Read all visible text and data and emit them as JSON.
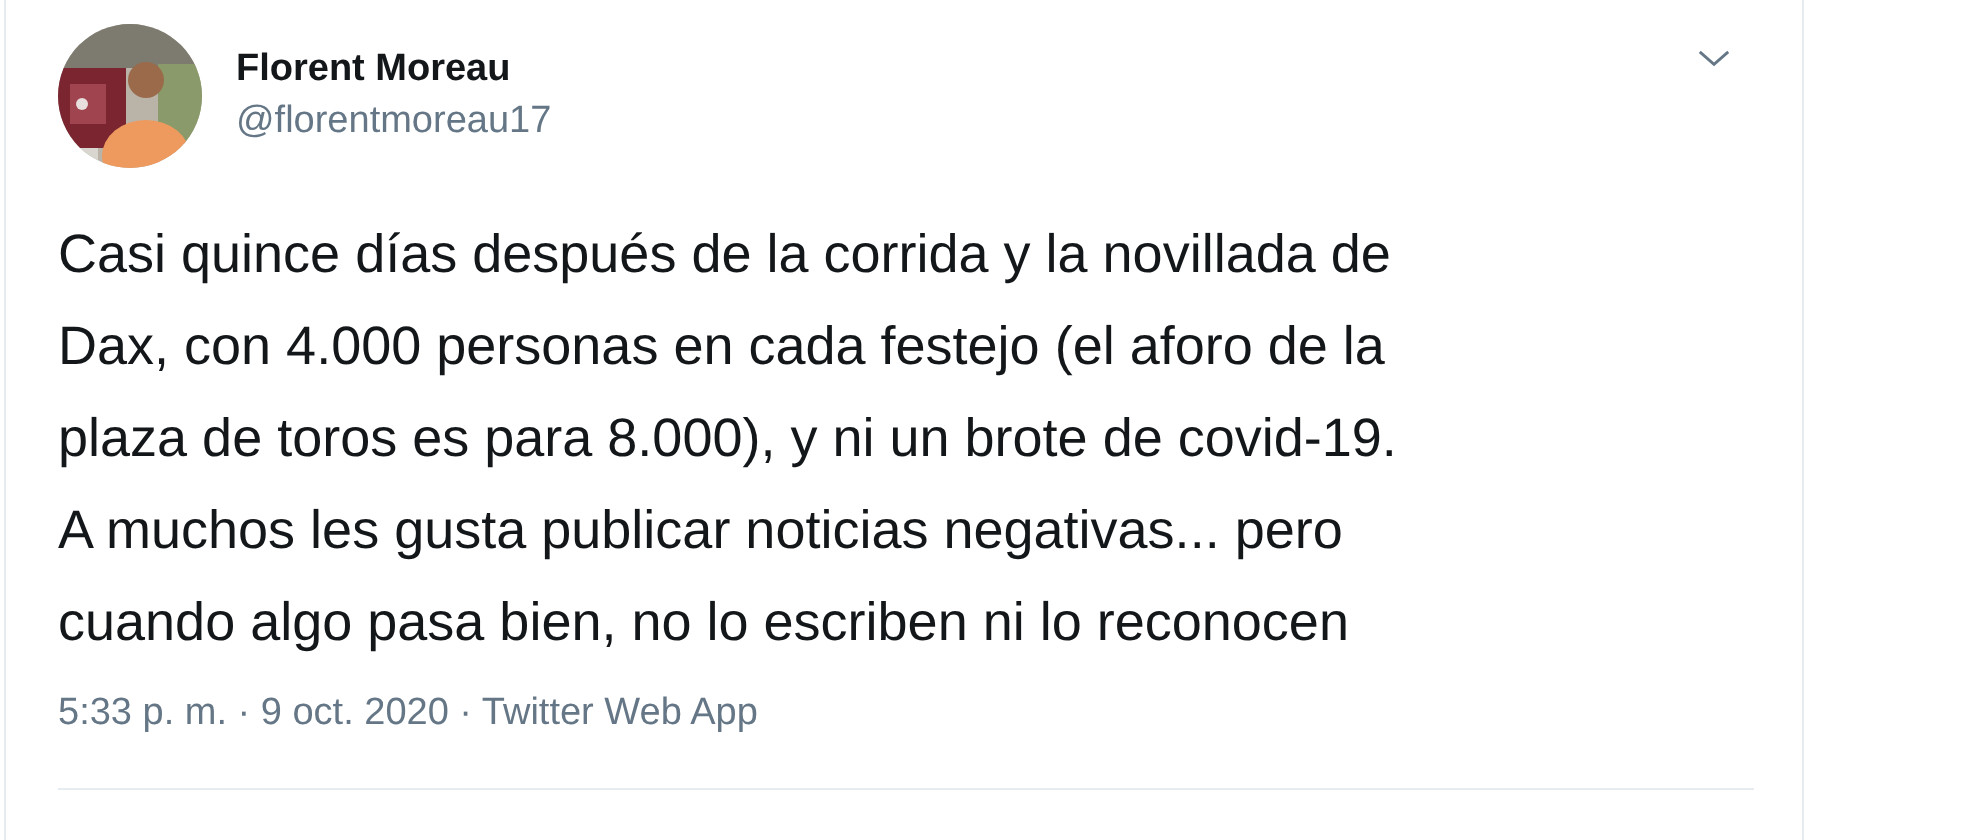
{
  "author": {
    "name": "Florent Moreau",
    "handle": "@florentmoreau17"
  },
  "tweet": {
    "lines": [
      "Casi quince días después de la corrida y la novillada de",
      "Dax, con 4.000 personas en cada festejo (el aforo de la",
      "plaza de toros es para 8.000), y ni un brote de covid-19.",
      "A muchos les gusta publicar noticias negativas... pero",
      "cuando algo pasa bien, no lo escriben ni lo reconocen"
    ]
  },
  "meta": "5:33 p. m. · 9 oct. 2020 · Twitter Web App"
}
